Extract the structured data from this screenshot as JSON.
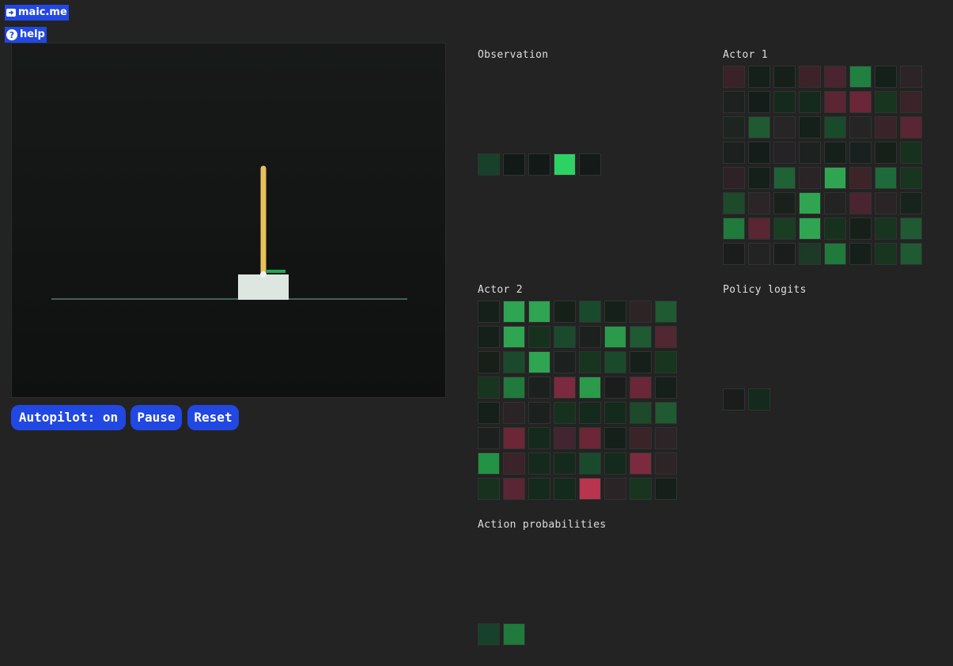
{
  "links": {
    "maic": {
      "label": "maic.me",
      "icon": "arrow-box-icon"
    },
    "help": {
      "label": "help",
      "icon": "question-circle-icon"
    }
  },
  "controls": {
    "autopilot": "Autopilot: on",
    "pause": "Pause",
    "reset": "Reset"
  },
  "colors": {
    "button_bg": "#2148e2",
    "pole": "#e8c15d",
    "cart": "#dde6e1",
    "track": "#46605a",
    "indicator": "#22a653",
    "positive_strong": "#2db85a",
    "negative_strong": "#b9344f"
  },
  "panels": {
    "observation": {
      "title": "Observation",
      "cols": 5,
      "cells": [
        "#17412a",
        "#121a17",
        "#121a17",
        "#2cd264",
        "#141a18"
      ]
    },
    "actor1": {
      "title": "Actor 1",
      "cols": 8,
      "cells": [
        "#3a2228",
        "#142019",
        "#162019",
        "#3d2229",
        "#4a2430",
        "#1f8040",
        "#142019",
        "#2c2427",
        "#1d2220",
        "#141d19",
        "#142a1d",
        "#142a1d",
        "#5a2634",
        "#6b2638",
        "#17351f",
        "#3a2329",
        "#1e2420",
        "#1f5a33",
        "#272525",
        "#142019",
        "#1a4a2c",
        "#242524",
        "#3a2329",
        "#5a2634",
        "#1c2120",
        "#141d19",
        "#252325",
        "#1d2220",
        "#142019",
        "#182120",
        "#162019",
        "#16321f",
        "#2f2227",
        "#142019",
        "#1e6236",
        "#2a2426",
        "#2fa552",
        "#3c2429",
        "#1f6a3a",
        "#17351f",
        "#1c4a2b",
        "#2c2527",
        "#1a211d",
        "#2fa552",
        "#232323",
        "#4a2430",
        "#2a2426",
        "#17241d",
        "#1f7a3c",
        "#5a2634",
        "#1a3e24",
        "#2fa552",
        "#16321f",
        "#162019",
        "#17351f",
        "#1f5a33",
        "#1a1d1c",
        "#232323",
        "#1a1d1c",
        "#1c3a25",
        "#1f7a3c",
        "#142019",
        "#17351f",
        "#1f5a33"
      ]
    },
    "actor2": {
      "title": "Actor 2",
      "cols": 8,
      "cells": [
        "#142019",
        "#2fa552",
        "#2fa552",
        "#162019",
        "#1a4a2c",
        "#142019",
        "#2c2427",
        "#1f5a33",
        "#142019",
        "#2fa552",
        "#16321f",
        "#1a4a2c",
        "#1c211f",
        "#2b9a4a",
        "#1f5a33",
        "#512732",
        "#162019",
        "#1a4a2c",
        "#2fa552",
        "#1c211f",
        "#17351f",
        "#1a4a2c",
        "#142019",
        "#17351f",
        "#17351f",
        "#1f7a3c",
        "#1c211f",
        "#7c2a40",
        "#2b9a4a",
        "#1a1d1c",
        "#6b2638",
        "#142019",
        "#142019",
        "#2a2426",
        "#1c211f",
        "#16321f",
        "#142a1d",
        "#142a1d",
        "#1c4a2b",
        "#1f5a33",
        "#1c211f",
        "#6b2638",
        "#142a1d",
        "#422531",
        "#6b2638",
        "#142019",
        "#3a2329",
        "#2c2427",
        "#229245",
        "#3a2329",
        "#142a1d",
        "#142a1d",
        "#1a4a2c",
        "#142a1d",
        "#7c2a40",
        "#2c2427",
        "#16321f",
        "#5a2634",
        "#142a1d",
        "#142a1d",
        "#b9344f",
        "#2a2426",
        "#17351f",
        "#142019"
      ]
    },
    "policy_logits": {
      "title": "Policy logits",
      "cols": 2,
      "cells": [
        "#1a1d1c",
        "#142a1d"
      ]
    },
    "action_probabilities": {
      "title": "Action probabilities",
      "cols": 2,
      "cells": [
        "#17412a",
        "#1f7a3c"
      ]
    }
  }
}
